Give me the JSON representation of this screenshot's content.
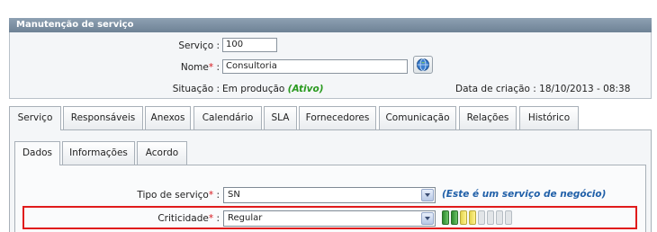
{
  "panel": {
    "title": "Manutenção de serviço",
    "servico_label": "Serviço :",
    "servico_value": "100",
    "nome_label": "Nome",
    "nome_colon": " :",
    "nome_value": "Consultoria",
    "required_mark": "*",
    "situacao_label": "Situação :",
    "situacao_value": "Em produção",
    "situacao_status": "(Ativo)",
    "data_criacao_label": "Data de criação :",
    "data_criacao_value": "18/10/2013 - 08:38"
  },
  "tabs": [
    {
      "label": "Serviço",
      "active": true
    },
    {
      "label": "Responsáveis"
    },
    {
      "label": "Anexos"
    },
    {
      "label": "Calendário"
    },
    {
      "label": "SLA"
    },
    {
      "label": "Fornecedores"
    },
    {
      "label": "Comunicação"
    },
    {
      "label": "Relações"
    },
    {
      "label": "Histórico"
    }
  ],
  "subtabs": [
    {
      "label": "Dados",
      "active": true
    },
    {
      "label": "Informações"
    },
    {
      "label": "Acordo"
    }
  ],
  "form": {
    "tipo_label": "Tipo de serviço",
    "tipo_value": "SN",
    "tipo_note": "(Este é um serviço de negócio)",
    "criticidade_label": "Criticidade",
    "criticidade_value": "Regular",
    "colon": " :",
    "criticidade_level": 2,
    "criticidade_partial": 2,
    "criticidade_total": 8
  },
  "colors": {
    "required": "#d8141a",
    "status_active": "#2a9a1f",
    "note": "#1f5fa8",
    "highlight_border": "#e01b1b"
  }
}
